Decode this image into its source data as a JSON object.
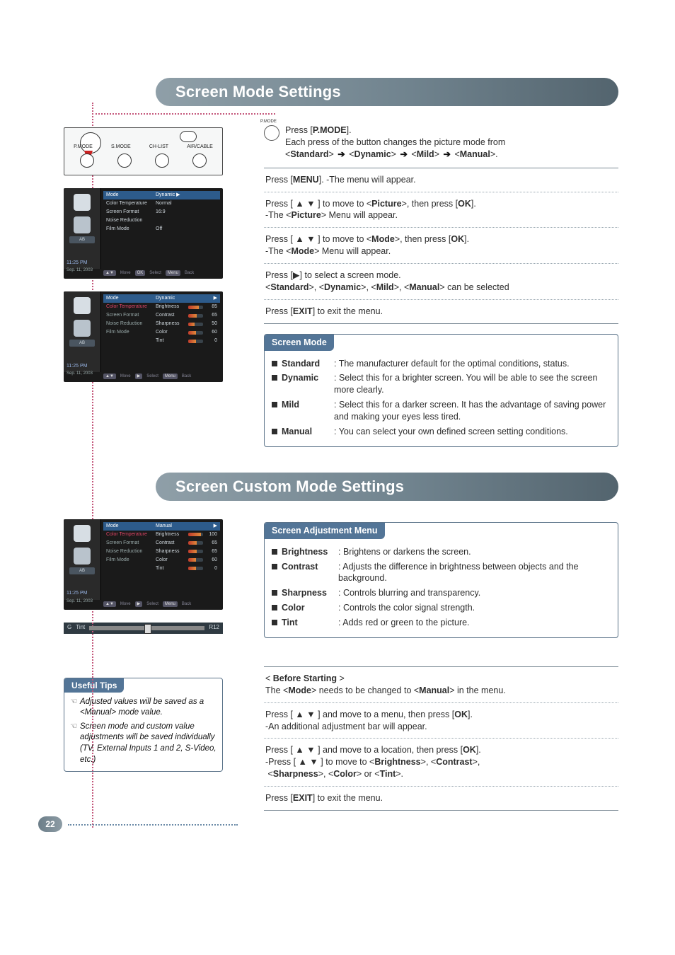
{
  "page_number": "22",
  "section1": {
    "title": "Screen Mode Settings",
    "remote_labels": [
      "P.MODE",
      "S.MODE",
      "CH-LIST",
      "AIR/CABLE"
    ],
    "pmode": {
      "press": "Press [",
      "btn": "P.MODE",
      "press_end": "].",
      "line2a": "Each press of the button changes the picture mode from",
      "seq": [
        "<",
        "Standard",
        "> ",
        " ",
        "<",
        "Dynamic",
        "> ",
        " ",
        "<",
        "Mild",
        "> ",
        " ",
        "<",
        "Manual",
        ">."
      ]
    },
    "steps": [
      "Press [<b>MENU</b>]. -The menu will appear.",
      "Press [ <span class='tri'>▲</span> <span class='tri'>▼</span> ] to move to &lt;<b>Picture</b>&gt;, then press [<b>OK</b>].<br>-The &lt;<b>Picture</b>&gt; Menu will appear.",
      "Press [ <span class='tri'>▲</span> <span class='tri'>▼</span> ] to move to &lt;<b>Mode</b>&gt;, then press [<b>OK</b>].<br>-The &lt;<b>Mode</b>&gt; Menu will appear.",
      "Press [<span class='tri'>▶</span>] to select a screen mode.<br>&lt;<b>Standard</b>&gt;, &lt;<b>Dynamic</b>&gt;, &lt;<b>Mild</b>&gt;, &lt;<b>Manual</b>&gt; can be selected",
      "Press [<b>EXIT</b>] to exit the menu."
    ],
    "box": {
      "title": "Screen Mode",
      "items": [
        {
          "term": "Standard",
          "desc": ": The manufacturer default for the optimal conditions, status."
        },
        {
          "term": "Dynamic",
          "desc": ": Select this for a brighter screen. You will be able to see the screen more clearly."
        },
        {
          "term": "Mild",
          "desc": ": Select this for a darker screen. It has the advantage of saving power and making your eyes less tired."
        },
        {
          "term": "Manual",
          "desc": ": You can select your own defined screen setting conditions."
        }
      ]
    },
    "osd1": {
      "clock": "11:25 PM",
      "date": "Sep. 11, 2003",
      "ab": "AB",
      "rows": [
        {
          "k": "Mode",
          "v": "Dynamic",
          "hl": true,
          "arrow": true
        },
        {
          "k": "Color Temperature",
          "v": "Normal"
        },
        {
          "k": "Screen Format",
          "v": "16:9"
        },
        {
          "k": "Noise Reduction",
          "v": ""
        },
        {
          "k": "Film Mode",
          "v": "Off"
        }
      ],
      "foot": [
        "▲▼",
        "Move",
        "OK",
        "Select",
        "Menu",
        "Back"
      ]
    },
    "osd2": {
      "clock": "11:25 PM",
      "date": "Sep. 11, 2003",
      "ab": "AB",
      "left": [
        "Mode",
        "Color Temperature",
        "Screen Format",
        "Noise Reduction",
        "Film Mode"
      ],
      "right_header": "Dynamic",
      "bars": [
        {
          "k": "Brightness",
          "v": "85",
          "w": "72%"
        },
        {
          "k": "Contrast",
          "v": "65",
          "w": "55%"
        },
        {
          "k": "Sharpness",
          "v": "50",
          "w": "42%"
        },
        {
          "k": "Color",
          "v": "60",
          "w": "50%"
        },
        {
          "k": "Tint",
          "v": "0",
          "w": "50%"
        }
      ],
      "foot": [
        "▲▼",
        "Move",
        "▶",
        "Select",
        "Menu",
        "Back"
      ]
    }
  },
  "section2": {
    "title": "Screen Custom Mode Settings",
    "osd": {
      "clock": "11:25 PM",
      "date": "Sep. 11, 2003",
      "ab": "AB",
      "left": [
        "Mode",
        "Color Temperature",
        "Screen Format",
        "Noise Reduction",
        "Film Mode"
      ],
      "right_header": "Manual",
      "bars": [
        {
          "k": "Brightness",
          "v": "100",
          "w": "85%"
        },
        {
          "k": "Contrast",
          "v": "65",
          "w": "55%"
        },
        {
          "k": "Sharpness",
          "v": "65",
          "w": "55%"
        },
        {
          "k": "Color",
          "v": "60",
          "w": "50%"
        },
        {
          "k": "Tint",
          "v": "0",
          "w": "50%"
        }
      ],
      "foot": [
        "▲▼",
        "Move",
        "▶",
        "Select",
        "Menu",
        "Back"
      ]
    },
    "tint": {
      "label": "Tint",
      "value": "R12",
      "tick": "G"
    },
    "box": {
      "title": "Screen Adjustment Menu",
      "items": [
        {
          "term": "Brightness",
          "desc": ": Brightens or darkens the screen."
        },
        {
          "term": "Contrast",
          "desc": ": Adjusts the difference in brightness between objects and the background."
        },
        {
          "term": "Sharpness",
          "desc": ": Controls blurring and transparency."
        },
        {
          "term": "Color",
          "desc": ": Controls the color signal strength."
        },
        {
          "term": "Tint",
          "desc": ": Adds red or green to the picture."
        }
      ]
    },
    "steps": [
      "&lt; <b>Before Starting</b> &gt;<br>The &lt;<b>Mode</b>&gt; needs to be changed to &lt;<b>Manual</b>&gt; in the menu.",
      "Press [ <span class='tri'>▲</span> <span class='tri'>▼</span> ] and move to a menu, then press [<b>OK</b>].<br>-An additional adjustment bar will appear.",
      "Press [ <span class='tri'>▲</span> <span class='tri'>▼</span> ] and move to a location, then press [<b>OK</b>].<br>-Press [ <span class='tri'>▲</span> <span class='tri'>▼</span> ] to move to &lt;<b>Brightness</b>&gt;, &lt;<b>Contrast</b>&gt;,<br>&nbsp;&lt;<b>Sharpness</b>&gt;, &lt;<b>Color</b>&gt; or &lt;<b>Tint</b>&gt;.",
      "Press [<b>EXIT</b>] to exit the menu."
    ],
    "tips": {
      "title": "Useful Tips",
      "items": [
        "Adjusted values will be saved as a <Manual> mode value.",
        "Screen mode and custom value adjustments will be saved individually (TV, External Inputs 1 and 2, S-Video, etc.)"
      ]
    }
  }
}
